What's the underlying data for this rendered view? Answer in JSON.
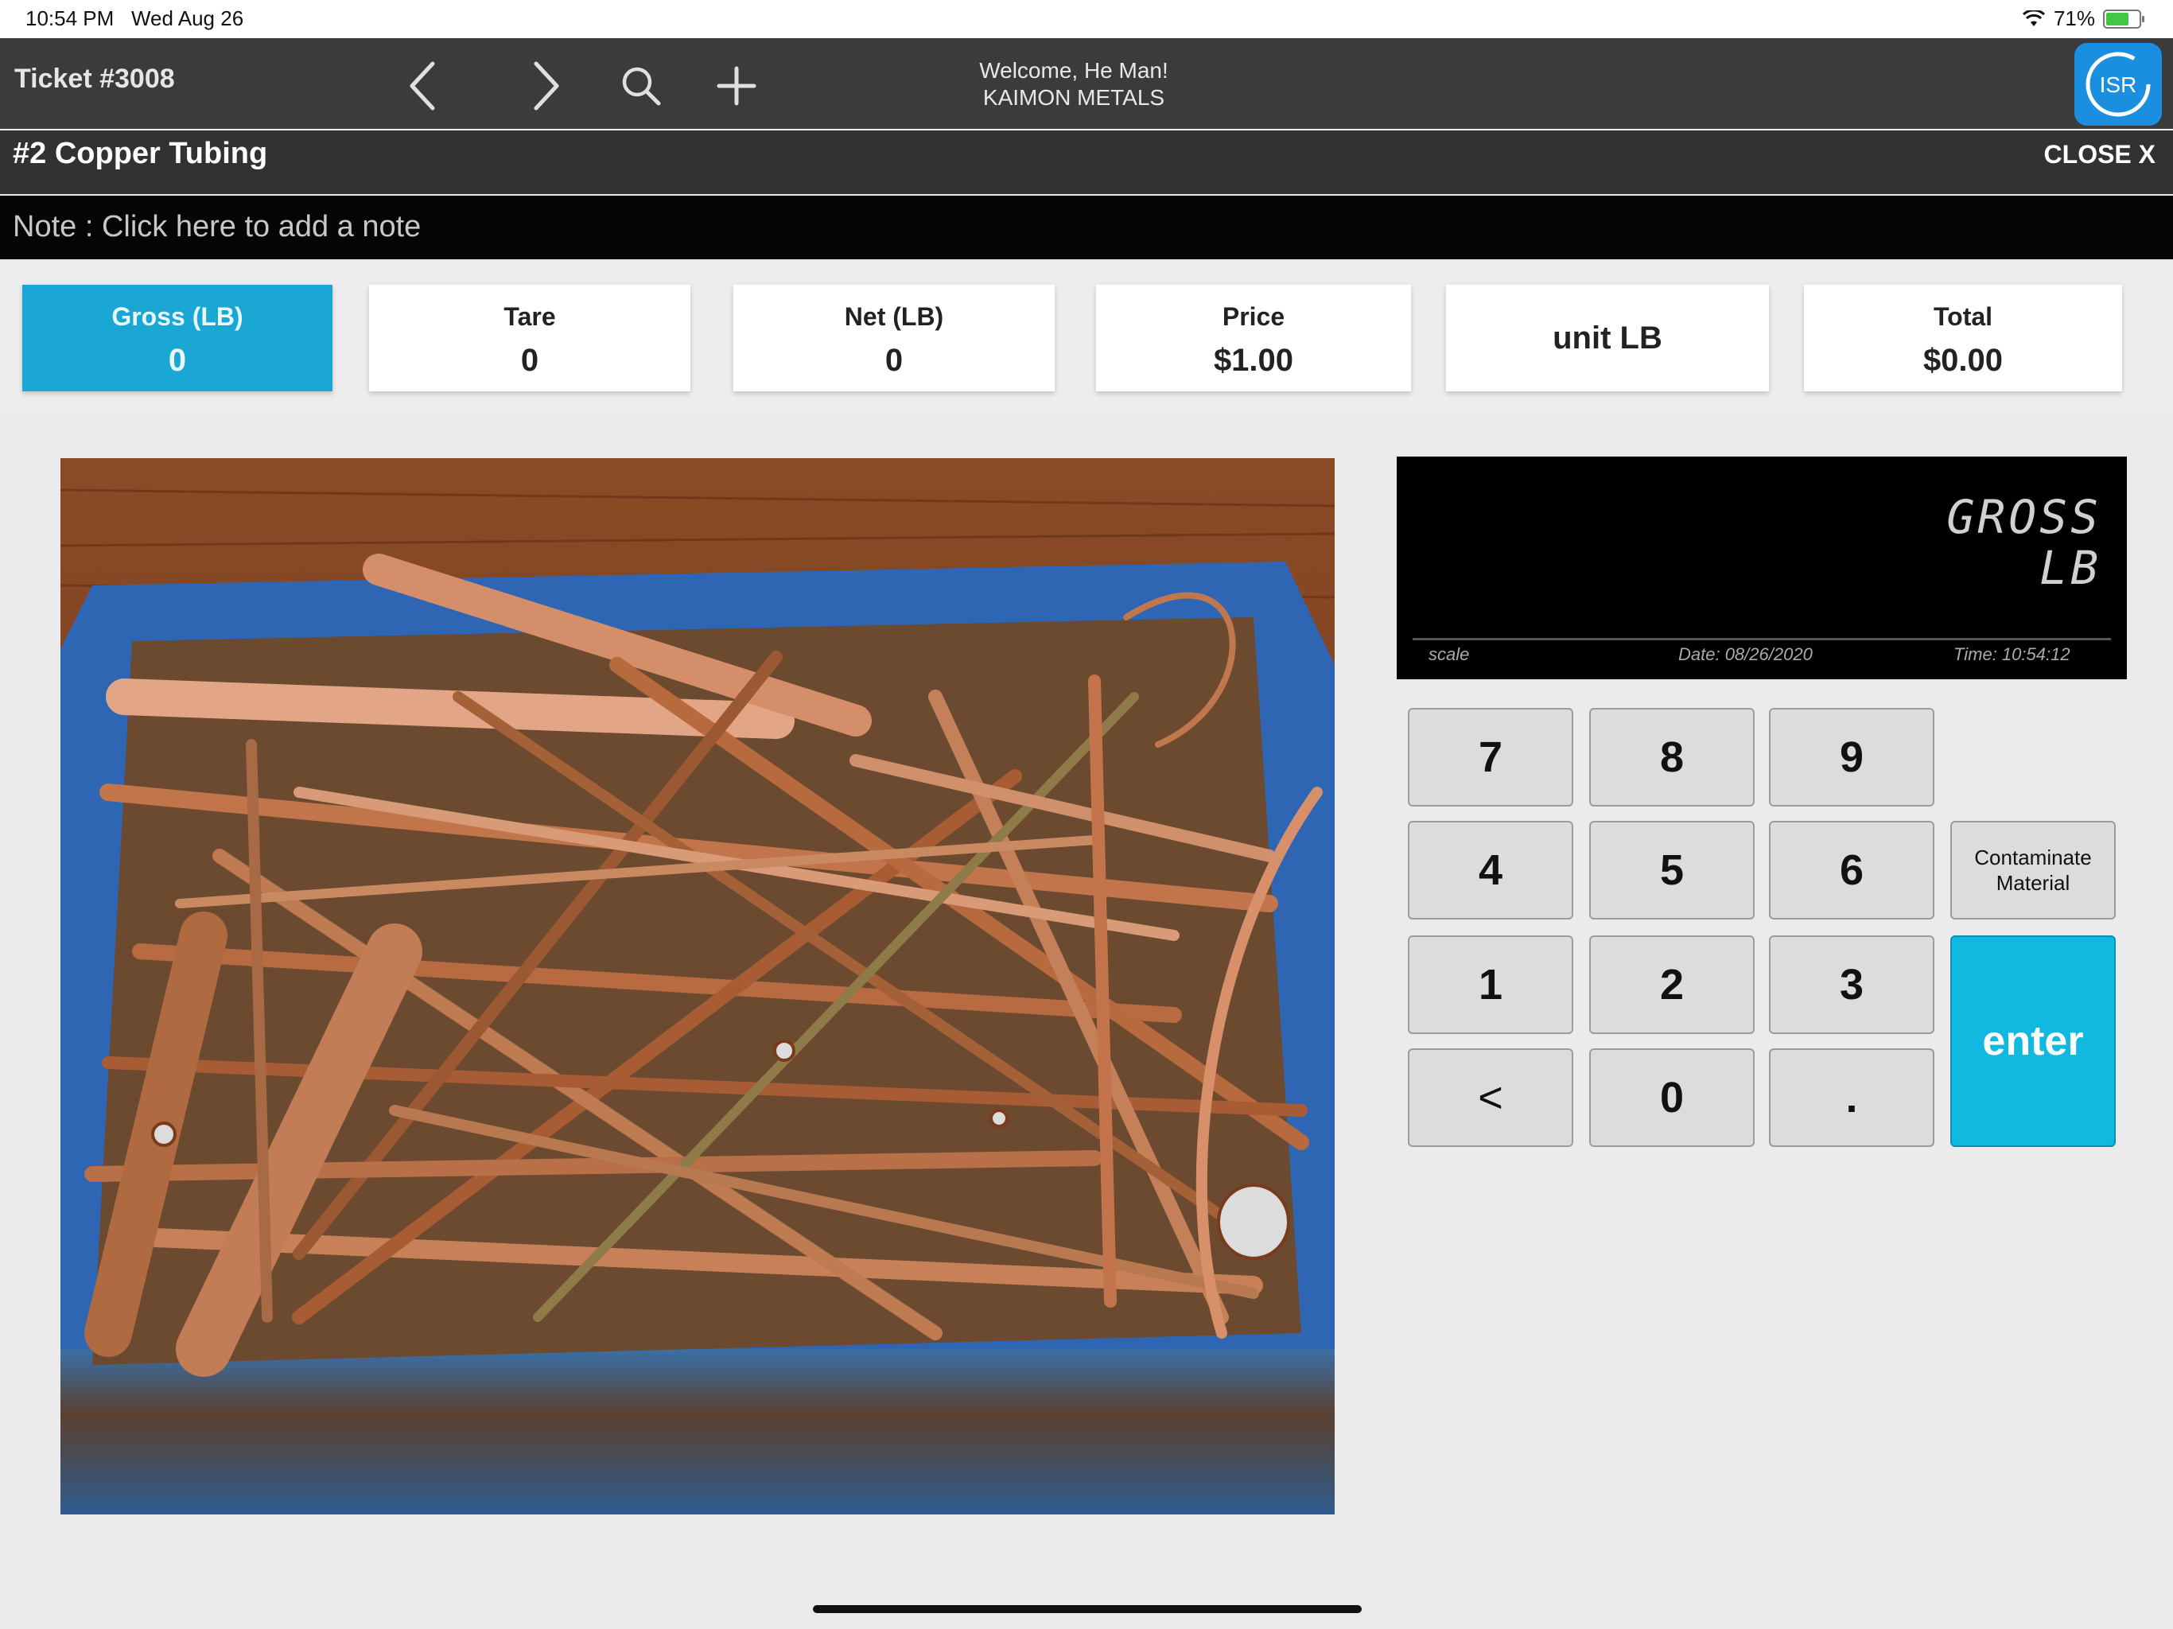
{
  "status_bar": {
    "time": "10:54 PM",
    "date": "Wed Aug 26",
    "battery": "71%",
    "battery_level": 0.71,
    "wifi_icon": "wifi-icon"
  },
  "nav": {
    "ticket": "Ticket #3008",
    "welcome": "Welcome, He Man!",
    "company": "KAIMON METALS",
    "logo_text": "ISR"
  },
  "item": {
    "title": "#2 Copper Tubing",
    "close_label": "CLOSE X",
    "note": "Note : Click here to add a note"
  },
  "fields": {
    "gross": {
      "label": "Gross (LB)",
      "value": "0"
    },
    "tare": {
      "label": "Tare",
      "value": "0"
    },
    "net": {
      "label": "Net (LB)",
      "value": "0"
    },
    "price": {
      "label": "Price",
      "value": "$1.00"
    },
    "unit": {
      "value": "unit LB"
    },
    "total": {
      "label": "Total",
      "value": "$0.00"
    }
  },
  "scale": {
    "mode": "GROSS",
    "unit": "LB",
    "source": "scale",
    "date": "Date: 08/26/2020",
    "time": "Time: 10:54:12"
  },
  "keypad": {
    "k7": "7",
    "k8": "8",
    "k9": "9",
    "k4": "4",
    "k5": "5",
    "k6": "6",
    "k1": "1",
    "k2": "2",
    "k3": "3",
    "back": "<",
    "k0": "0",
    "dot": ".",
    "contaminate_line1": "Contaminate",
    "contaminate_line2": "Material",
    "enter": "enter"
  },
  "colors": {
    "accent": "#1aa7d4",
    "enter": "#11b8e0",
    "nav_bg": "#3b3b3b",
    "title_bg": "#323232"
  }
}
